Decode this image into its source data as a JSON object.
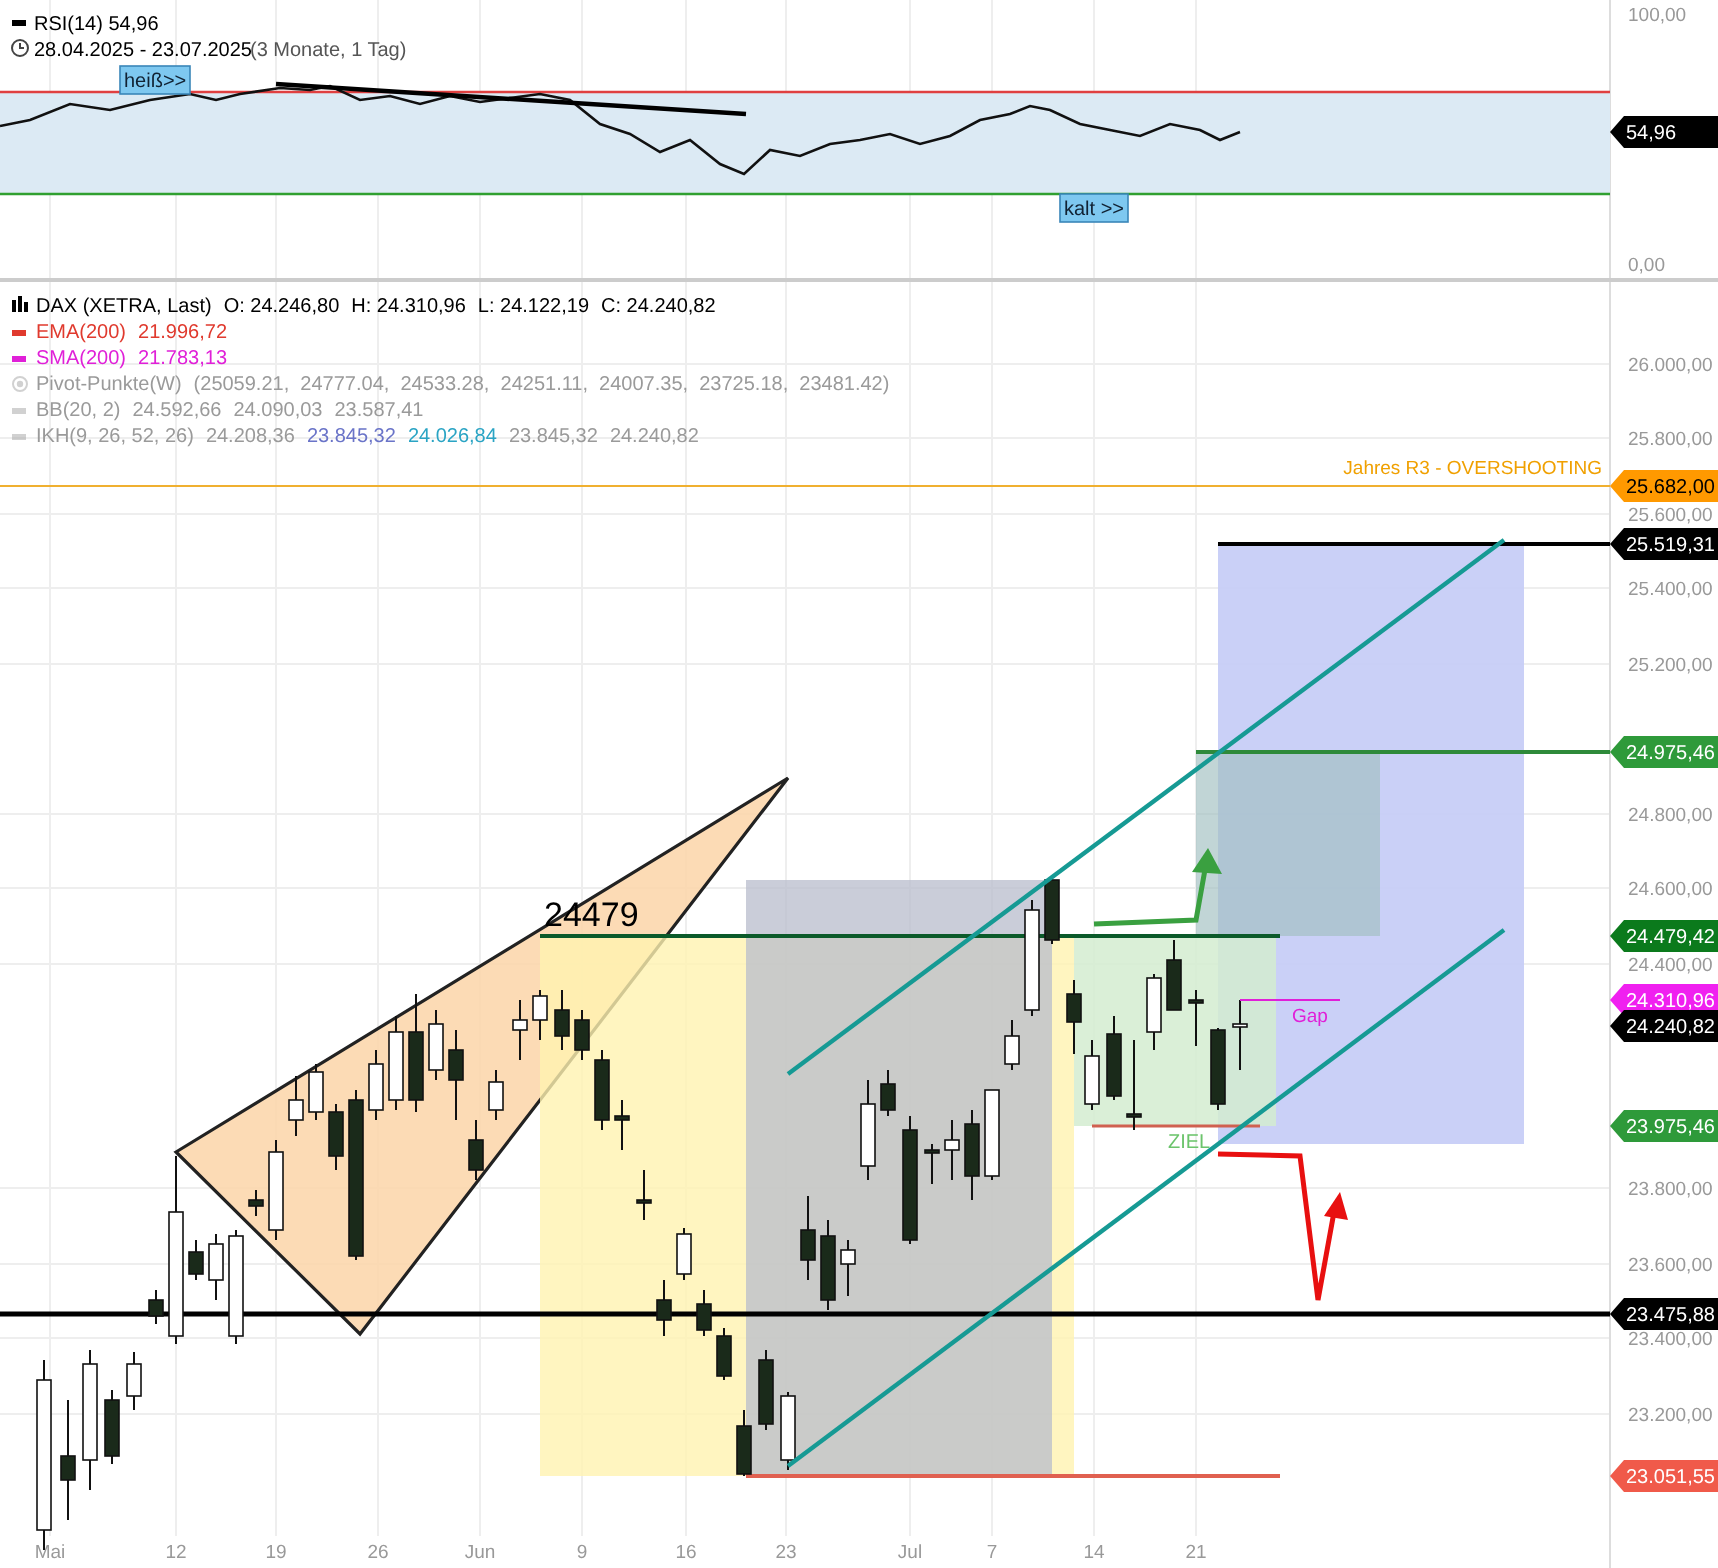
{
  "rsi_panel": {
    "legend": {
      "name": "RSI(14)",
      "value": "54,96"
    },
    "date_range": "28.04.2025 - 23.07.2025",
    "period": "(3 Monate, 1 Tag)",
    "badges": [
      {
        "text": "heiß>>"
      },
      {
        "text": "kalt >>"
      }
    ],
    "axis_labels": [
      "100,00",
      "0,00"
    ],
    "price_label": {
      "text": "54,96",
      "color": "#000000"
    }
  },
  "main_panel": {
    "legend": [
      {
        "kind": "ohlc",
        "name": "DAX (XETRA, Last)",
        "color": "#000000",
        "hidden": false,
        "values": [
          {
            "text": "O: 24.246,80"
          },
          {
            "text": "H: 24.310,96"
          },
          {
            "text": "L: 24.122,19"
          },
          {
            "text": "C: 24.240,82"
          }
        ]
      },
      {
        "kind": "line",
        "name": "EMA(200)",
        "color": "#e03a2e",
        "hidden": false,
        "values": [
          {
            "text": "21.996,72"
          }
        ]
      },
      {
        "kind": "line",
        "name": "SMA(200)",
        "color": "#e020d8",
        "hidden": false,
        "values": [
          {
            "text": "21.783,13"
          }
        ]
      },
      {
        "kind": "pivot",
        "name": "Pivot-Punkte(W)",
        "color": "#9a9a9a",
        "hidden": true,
        "values": [
          {
            "text": "(25059.21,  24777.04,  24533.28,  24251.11,  24007.35,  23725.18,  23481.42)"
          }
        ]
      },
      {
        "kind": "line",
        "name": "BB(20, 2)",
        "color": "#9a9a9a",
        "hidden": true,
        "values": [
          {
            "text": "24.592,66"
          },
          {
            "text": "24.090,03"
          },
          {
            "text": "23.587,41"
          }
        ]
      },
      {
        "kind": "line",
        "name": "IKH(9, 26, 52, 26)",
        "color": "#9a9a9a",
        "hidden": true,
        "values": [
          {
            "text": "24.208,36"
          },
          {
            "text": "23.845,32",
            "color": "#6a74c8"
          },
          {
            "text": "24.026,84",
            "color": "#2aa4c4"
          },
          {
            "text": "23.845,32"
          },
          {
            "text": "24.240,82"
          }
        ]
      }
    ],
    "chart_labels": [
      {
        "text": "Jahres R3 - OVERSHOOTING",
        "color": "#f0a000"
      },
      {
        "text": "24479",
        "color": "#000000"
      },
      {
        "text": "Gap",
        "color": "#e020d8"
      },
      {
        "text": "ZIEL",
        "color": "#6cc46c"
      }
    ],
    "axis_labels": [
      "26.000,00",
      "25.800,00",
      "25.600,00",
      "25.400,00",
      "25.200,00",
      "24.800,00",
      "24.600,00",
      "24.400,00",
      "23.800,00",
      "23.600,00",
      "23.400,00",
      "23.200,00"
    ],
    "price_labels": [
      {
        "text": "25.682,00",
        "color": "#ff9900"
      },
      {
        "text": "25.519,31",
        "color": "#000000"
      },
      {
        "text": "24.975,46",
        "color": "#2e9a3a"
      },
      {
        "text": "24.479,42",
        "color": "#0b7a1c"
      },
      {
        "text": "24.310,96",
        "color": "#f020f0"
      },
      {
        "text": "24.240,82",
        "color": "#000000"
      },
      {
        "text": "23.975,46",
        "color": "#2e9a3a"
      },
      {
        "text": "23.475,88",
        "color": "#000000"
      },
      {
        "text": "23.051,55",
        "color": "#f05a4a"
      }
    ]
  },
  "x_axis": [
    "Mai",
    "12",
    "19",
    "26",
    "Jun",
    "9",
    "16",
    "23",
    "Jul",
    "7",
    "14",
    "21"
  ]
}
